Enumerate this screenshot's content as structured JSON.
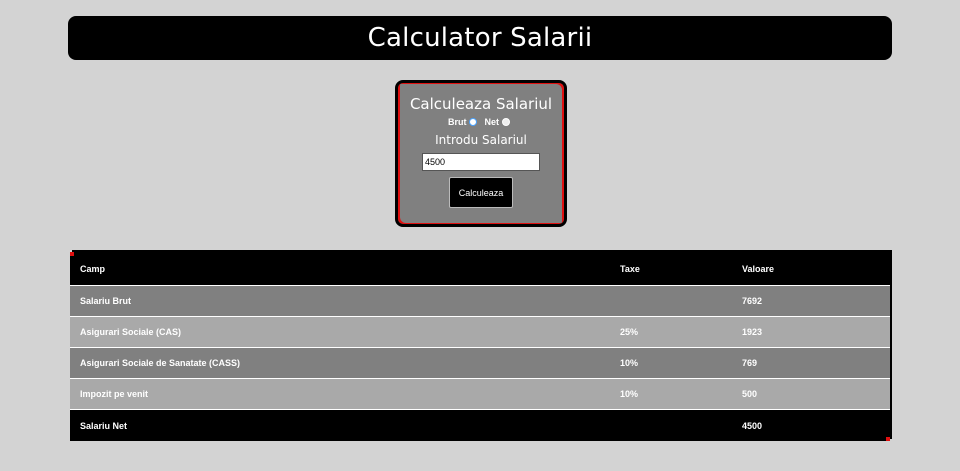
{
  "header": {
    "title": "Calculator Salarii"
  },
  "calculator": {
    "title": "Calculeaza Salariul",
    "radio_brut": "Brut",
    "radio_net": "Net",
    "input_label": "Introdu Salariul",
    "input_value": "4500",
    "button_label": "Calculeaza"
  },
  "table": {
    "headers": {
      "camp": "Camp",
      "taxe": "Taxe",
      "valoare": "Valoare"
    },
    "rows": [
      {
        "camp": "Salariu Brut",
        "taxe": "",
        "valoare": "7692"
      },
      {
        "camp": "Asigurari Sociale (CAS)",
        "taxe": "25%",
        "valoare": "1923"
      },
      {
        "camp": "Asigurari Sociale de Sanatate (CASS)",
        "taxe": "10%",
        "valoare": "769"
      },
      {
        "camp": "Impozit pe venit",
        "taxe": "10%",
        "valoare": "500"
      },
      {
        "camp": "Salariu Net",
        "taxe": "",
        "valoare": "4500"
      }
    ]
  },
  "colors": {
    "page_bg": "#d3d3d3",
    "panel": "#808080",
    "row_light": "#a9a9a9",
    "accent": "#e01010"
  }
}
